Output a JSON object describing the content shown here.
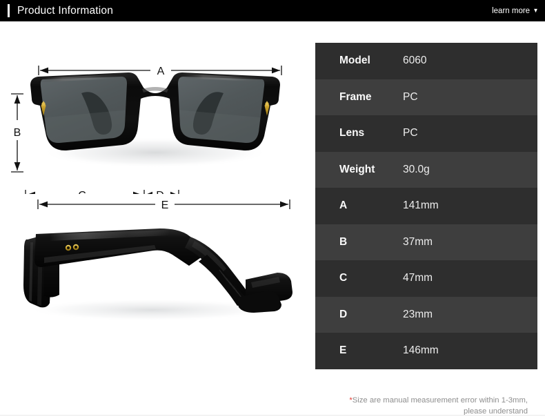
{
  "header": {
    "title": "Product Information",
    "learn_more_label": "learn more",
    "caret_icon": "chevron-down-icon",
    "background_color": "#000000",
    "text_color": "#ffffff"
  },
  "spec_table": {
    "row_colors": [
      "#2e2e2e",
      "#3e3e3e"
    ],
    "rows": [
      {
        "label": "Model",
        "value": "6060"
      },
      {
        "label": "Frame",
        "value": "PC"
      },
      {
        "label": "Lens",
        "value": "PC"
      },
      {
        "label": "Weight",
        "value": "30.0g"
      },
      {
        "label": "A",
        "value": "141mm"
      },
      {
        "label": "B",
        "value": "37mm"
      },
      {
        "label": "C",
        "value": "47mm"
      },
      {
        "label": "D",
        "value": "23mm"
      },
      {
        "label": "E",
        "value": "146mm"
      }
    ],
    "note": {
      "star": "*",
      "line1": "Size are manual measurement error within 1-3mm,",
      "line2": "please understand",
      "star_color": "#e2392f"
    }
  },
  "diagrams": {
    "front_view": {
      "name": "sunglasses-front-view",
      "frame_color": "#0d0d0d",
      "lens_color": "#545b5d",
      "accent_color": "#c9a227",
      "dimension_labels": {
        "a": "A",
        "b": "B",
        "c": "C",
        "d": "D"
      }
    },
    "side_view": {
      "name": "sunglasses-side-view",
      "frame_color": "#0d0d0d",
      "accent_color": "#c9a227",
      "dimension_labels": {
        "e": "E"
      }
    }
  }
}
